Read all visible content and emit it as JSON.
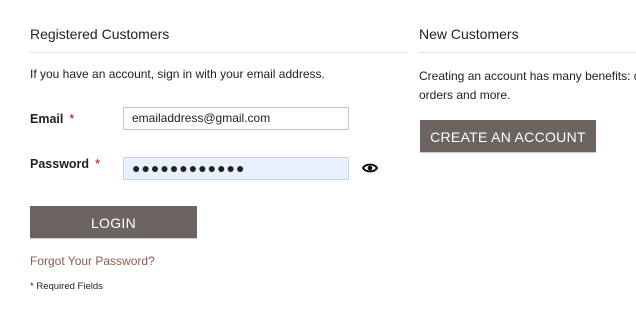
{
  "registered": {
    "title": "Registered Customers",
    "intro": "If you have an account, sign in with your email address.",
    "email_label": "Email",
    "email_value": "emailaddress@gmail.com",
    "password_label": "Password",
    "password_value": "●●●●●●●●●●●●",
    "required_marker": "*",
    "login_label": "LOGIN",
    "forgot_label": "Forgot Your Password?",
    "required_note": "* Required Fields"
  },
  "new_customers": {
    "title": "New Customers",
    "benefits_line1": "Creating an account has many benefits: ch",
    "benefits_line2": "orders and more.",
    "create_label": "CREATE AN ACCOUNT"
  },
  "icons": {
    "reveal_password": "eye-icon"
  },
  "colors": {
    "button_bg": "#6b6460",
    "link": "#8a5c4c",
    "required": "#b20000",
    "autofill_bg": "#e8f0fe"
  }
}
